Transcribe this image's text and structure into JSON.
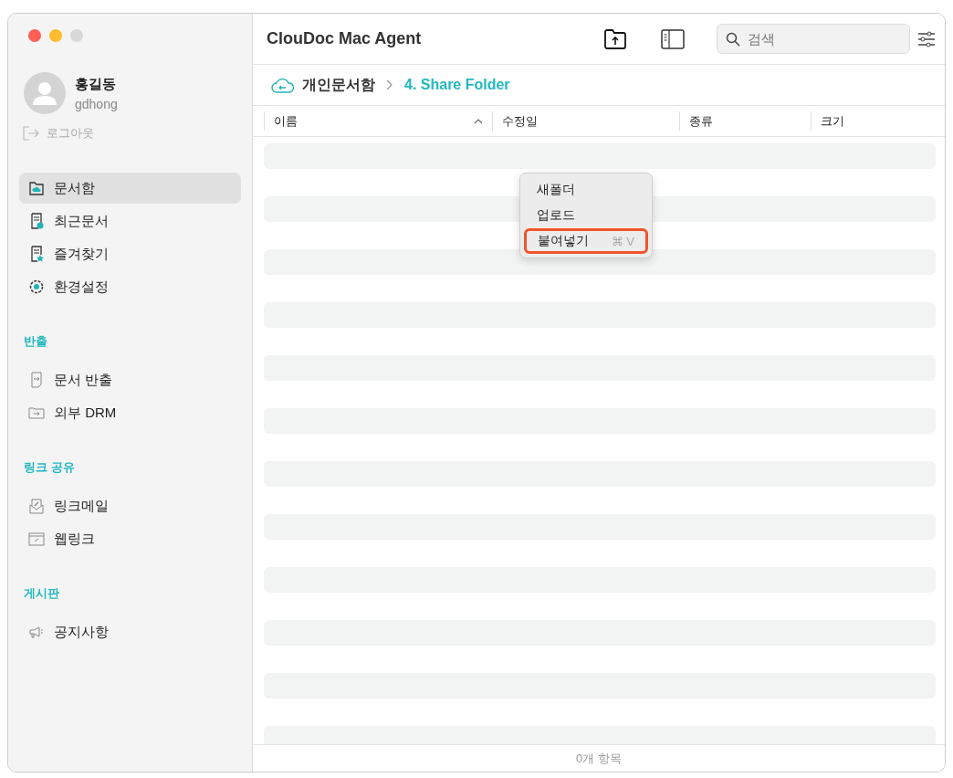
{
  "window": {
    "title": "ClouDoc Mac Agent"
  },
  "user": {
    "name": "홍길동",
    "id": "gdhong",
    "logout": "로그아웃"
  },
  "sidebar": {
    "items": [
      {
        "label": "문서함",
        "selected": true
      },
      {
        "label": "최근문서",
        "selected": false
      },
      {
        "label": "즐겨찾기",
        "selected": false
      },
      {
        "label": "환경설정",
        "selected": false
      }
    ],
    "sections": [
      {
        "title": "반출",
        "items": [
          {
            "label": "문서 반출",
            "selected": false
          },
          {
            "label": "외부 DRM",
            "selected": false
          }
        ]
      },
      {
        "title": "링크 공유",
        "items": [
          {
            "label": "링크메일",
            "selected": false
          },
          {
            "label": "웹링크",
            "selected": false
          }
        ]
      },
      {
        "title": "게시판",
        "items": [
          {
            "label": "공지사항",
            "selected": false
          }
        ]
      }
    ]
  },
  "search": {
    "placeholder": "검색"
  },
  "breadcrumb": [
    "개인문서함",
    "4. Share Folder"
  ],
  "table": {
    "columns": [
      {
        "label": "이름",
        "sorted": true
      },
      {
        "label": "수정일",
        "sorted": false
      },
      {
        "label": "종류",
        "sorted": false
      },
      {
        "label": "크기",
        "sorted": false
      }
    ]
  },
  "context_menu": [
    {
      "label": "새폴더",
      "selected": false
    },
    {
      "label": "업로드",
      "selected": false
    },
    {
      "label": "붙여넣기",
      "shortcut": "⌘ V",
      "selected": true
    }
  ],
  "status_bar": "0개 항목"
}
